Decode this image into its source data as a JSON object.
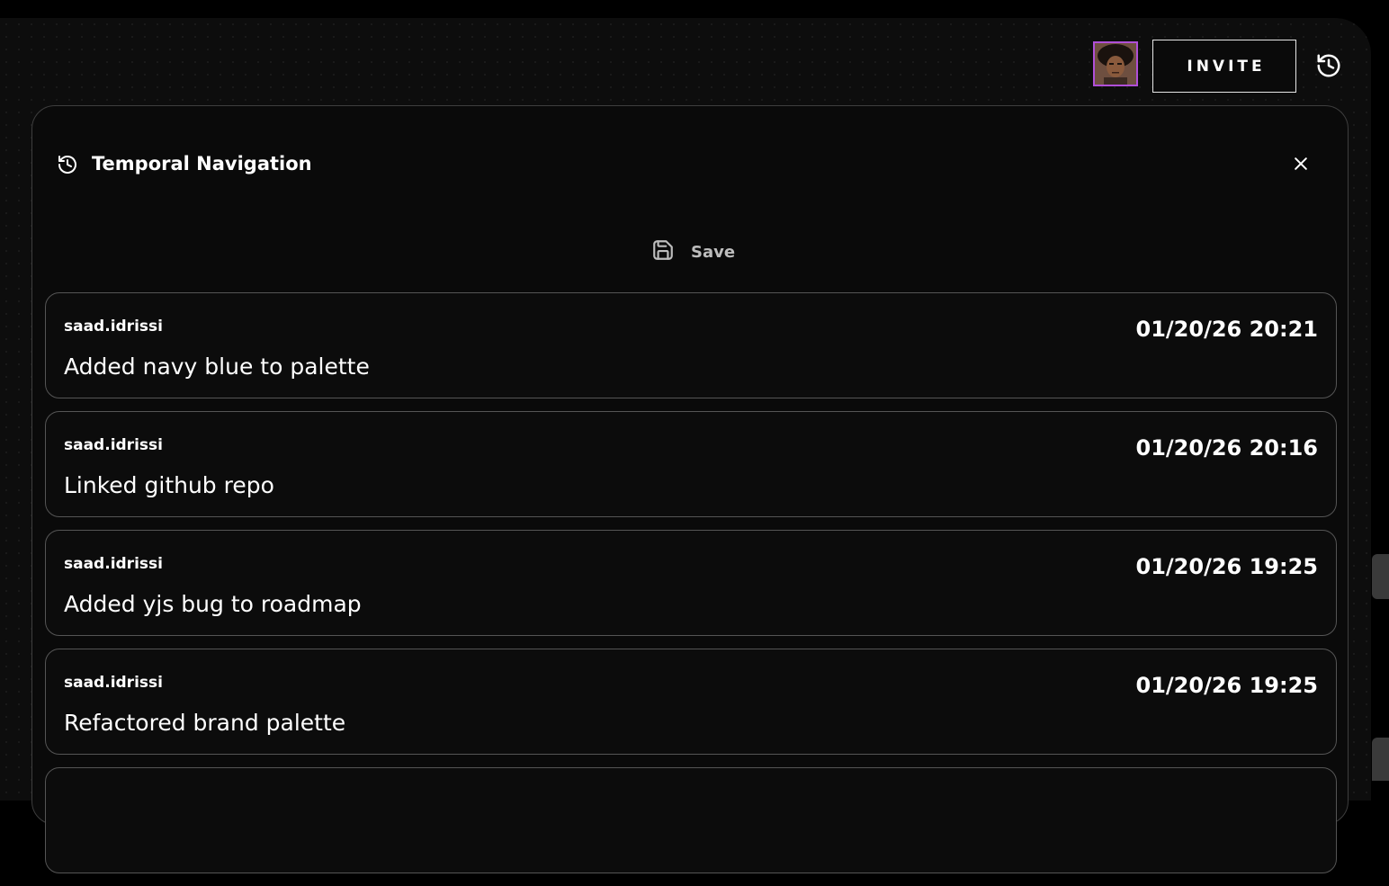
{
  "header": {
    "invite_label": "INVITE",
    "avatar_border_color": "#b04fd8",
    "history_icon": "history-icon"
  },
  "panel": {
    "title": "Temporal Navigation",
    "title_icon": "history-icon",
    "close_icon": "close-icon",
    "save_label": "Save",
    "save_icon": "save-icon",
    "entries": [
      {
        "user": "saad.idrissi",
        "timestamp": "01/20/26 20:21",
        "message": "Added navy blue to palette"
      },
      {
        "user": "saad.idrissi",
        "timestamp": "01/20/26 20:16",
        "message": "Linked github repo"
      },
      {
        "user": "saad.idrissi",
        "timestamp": "01/20/26 19:25",
        "message": "Added yjs bug to roadmap"
      },
      {
        "user": "saad.idrissi",
        "timestamp": "01/20/26 19:25",
        "message": "Refactored brand palette"
      },
      {
        "user": "",
        "timestamp": "",
        "message": ""
      }
    ]
  }
}
